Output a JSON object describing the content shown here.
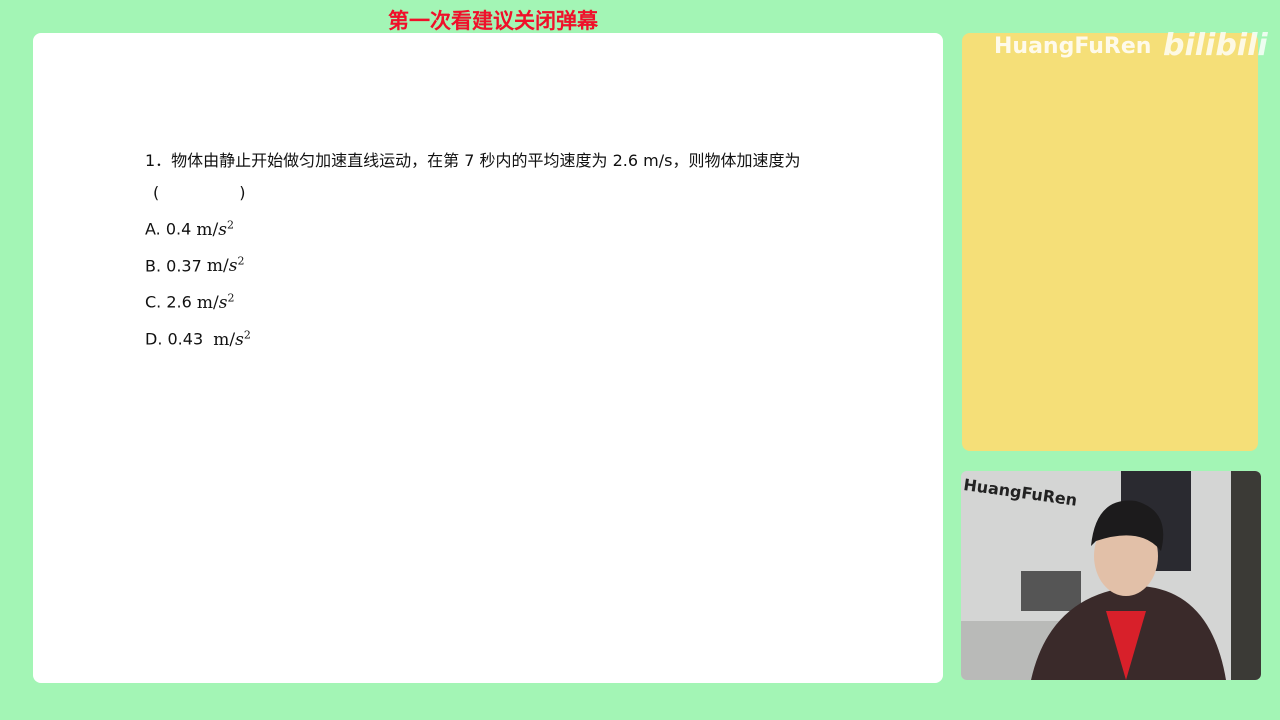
{
  "banner": "第一次看建议关闭弹幕",
  "question": {
    "stem": "1．物体由静止开始做匀加速直线运动，在第 7 秒内的平均速度为 2.6 m/s，则物体加速度为",
    "blank": "(　　　　　)",
    "options": [
      {
        "label": "A. 0.4",
        "unit": "m/",
        "var": "s",
        "exp": "2"
      },
      {
        "label": "B. 0.37",
        "unit": "m/",
        "var": "s",
        "exp": "2"
      },
      {
        "label": "C. 2.6",
        "unit": "m/",
        "var": "s",
        "exp": "2"
      },
      {
        "label": "D. 0.43 ",
        "unit": "m/",
        "var": "s",
        "exp": "2"
      }
    ]
  },
  "watermark": {
    "name": "HuangFuRen",
    "logo": "bilibili"
  },
  "webcam": {
    "label": "HuangFuRen"
  }
}
